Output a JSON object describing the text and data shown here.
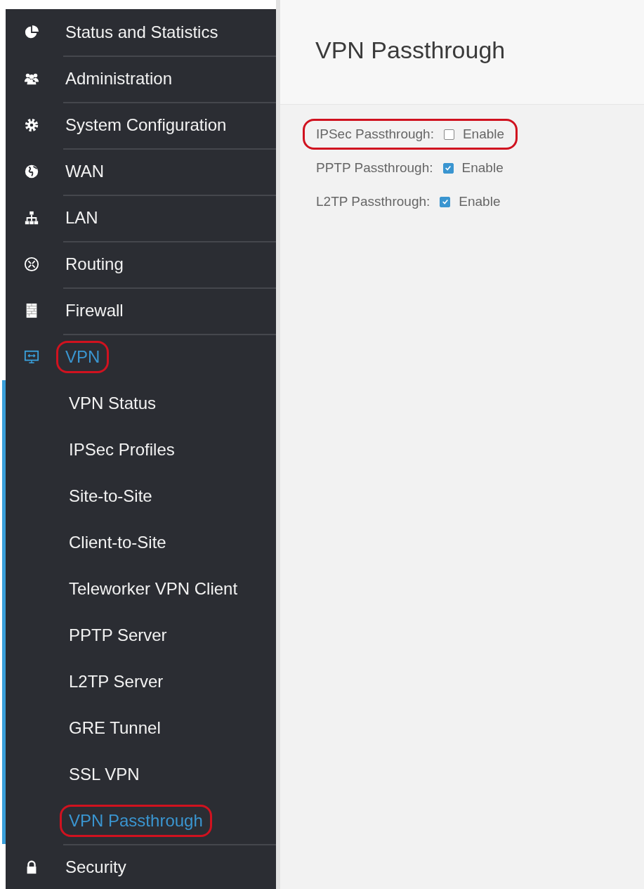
{
  "sidebar": {
    "items": [
      {
        "kind": "pie",
        "label": "Status and Statistics",
        "selected": false,
        "highlighted": false
      },
      {
        "kind": "people",
        "label": "Administration",
        "selected": false,
        "highlighted": false
      },
      {
        "kind": "gear",
        "label": "System Configuration",
        "selected": false,
        "highlighted": false
      },
      {
        "kind": "globe",
        "label": "WAN",
        "selected": false,
        "highlighted": false
      },
      {
        "kind": "network",
        "label": "LAN",
        "selected": false,
        "highlighted": false
      },
      {
        "kind": "router",
        "label": "Routing",
        "selected": false,
        "highlighted": false
      },
      {
        "kind": "wall",
        "label": "Firewall",
        "selected": false,
        "highlighted": false
      },
      {
        "kind": "monitor",
        "label": "VPN",
        "selected": true,
        "highlighted": true,
        "expanded": true,
        "children": [
          {
            "label": "VPN Status",
            "selected": false,
            "highlighted": false
          },
          {
            "label": "IPSec Profiles",
            "selected": false,
            "highlighted": false
          },
          {
            "label": "Site-to-Site",
            "selected": false,
            "highlighted": false
          },
          {
            "label": "Client-to-Site",
            "selected": false,
            "highlighted": false
          },
          {
            "label": "Teleworker VPN Client",
            "selected": false,
            "highlighted": false
          },
          {
            "label": "PPTP Server",
            "selected": false,
            "highlighted": false
          },
          {
            "label": "L2TP Server",
            "selected": false,
            "highlighted": false
          },
          {
            "label": "GRE Tunnel",
            "selected": false,
            "highlighted": false
          },
          {
            "label": "SSL VPN",
            "selected": false,
            "highlighted": false
          },
          {
            "label": "VPN Passthrough",
            "selected": true,
            "highlighted": true
          }
        ]
      },
      {
        "kind": "lock",
        "label": "Security",
        "selected": false,
        "highlighted": false
      }
    ]
  },
  "page": {
    "title": "VPN Passthrough",
    "fields": [
      {
        "label": "IPSec Passthrough:",
        "option": "Enable",
        "checked": false,
        "highlighted": true
      },
      {
        "label": "PPTP Passthrough:",
        "option": "Enable",
        "checked": true,
        "highlighted": false
      },
      {
        "label": "L2TP Passthrough:",
        "option": "Enable",
        "checked": true,
        "highlighted": false
      }
    ]
  }
}
